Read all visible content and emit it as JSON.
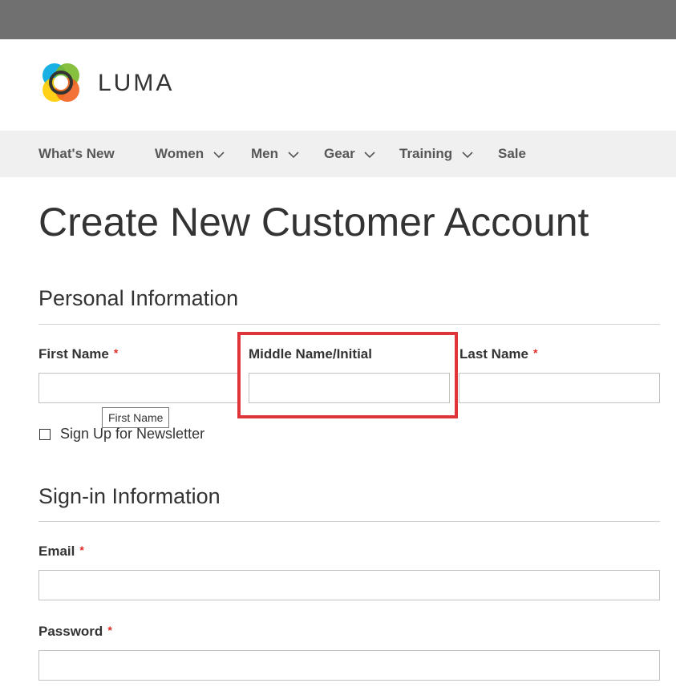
{
  "brand": {
    "name": "LUMA",
    "icon": "luma-logo-icon",
    "colors": [
      "#f26322",
      "#ffcc00",
      "#00a9e0",
      "#7ab82a"
    ]
  },
  "nav": {
    "items": [
      {
        "label": "What's New",
        "has_dropdown": false
      },
      {
        "label": "Women",
        "has_dropdown": true
      },
      {
        "label": "Men",
        "has_dropdown": true
      },
      {
        "label": "Gear",
        "has_dropdown": true
      },
      {
        "label": "Training",
        "has_dropdown": true
      },
      {
        "label": "Sale",
        "has_dropdown": false
      }
    ]
  },
  "page": {
    "title": "Create New Customer Account"
  },
  "personal": {
    "title": "Personal Information",
    "first_name": {
      "label": "First Name",
      "required": "*",
      "value": ""
    },
    "middle_name": {
      "label": "Middle Name/Initial",
      "value": ""
    },
    "last_name": {
      "label": "Last Name",
      "required": "*",
      "value": ""
    },
    "tooltip": "First Name",
    "newsletter": {
      "label": "Sign Up for Newsletter",
      "checked": false
    }
  },
  "signin": {
    "title": "Sign-in Information",
    "email": {
      "label": "Email",
      "required": "*",
      "value": ""
    },
    "password": {
      "label": "Password",
      "required": "*",
      "value": ""
    }
  },
  "colors": {
    "top_bar": "#6f706f",
    "nav_bg": "#f0f0f0",
    "required": "#e02b27",
    "highlight": "#e0343b"
  }
}
